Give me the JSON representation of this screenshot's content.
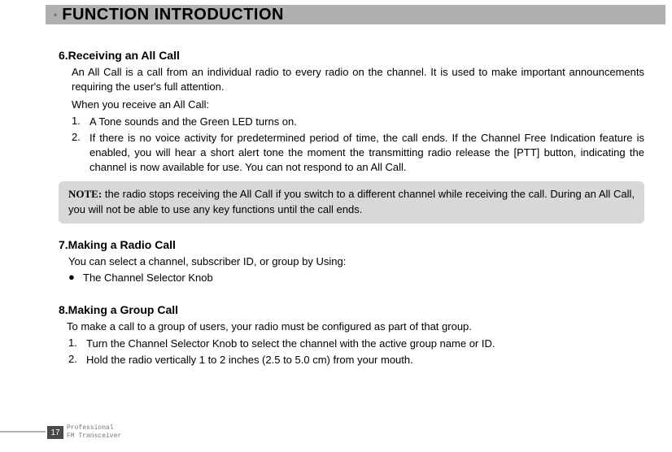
{
  "header": {
    "title": "FUNCTION INTRODUCTION"
  },
  "section6": {
    "heading": "6.Receiving an All Call",
    "intro": "An All Call is a call from an individual radio to every radio on the channel. It is used to make important announcements requiring the user's full attention.",
    "when": "When you receive an All Call:",
    "item1": "A Tone sounds and the Green LED turns on.",
    "item2": "If there is no voice activity for predetermined period of time, the call ends. If the Channel Free Indication feature is enabled, you will hear a short alert tone the moment the transmitting radio release the [PTT] button, indicating the channel is now available for use. You can not respond to an All Call.",
    "note_label": "NOTE:",
    "note": " the radio stops receiving the All Call if you switch to a different channel while receiving the call. During an All Call, you will not be able to use any key functions until the call ends."
  },
  "section7": {
    "heading": "7.Making a Radio Call",
    "intro": "You can select a channel, subscriber ID, or group by Using:",
    "bullet1": "The Channel Selector Knob"
  },
  "section8": {
    "heading": "8.Making a Group Call",
    "intro": "To make a call to a group of users, your radio must be configured as part of that group.",
    "item1": "Turn the Channel Selector Knob to select the channel with the active group name or ID.",
    "item2": "Hold the radio vertically 1 to 2 inches (2.5 to 5.0 cm) from your mouth."
  },
  "footer": {
    "page_number": "17",
    "line1": "Professional",
    "line2": "FM Transceiver"
  }
}
